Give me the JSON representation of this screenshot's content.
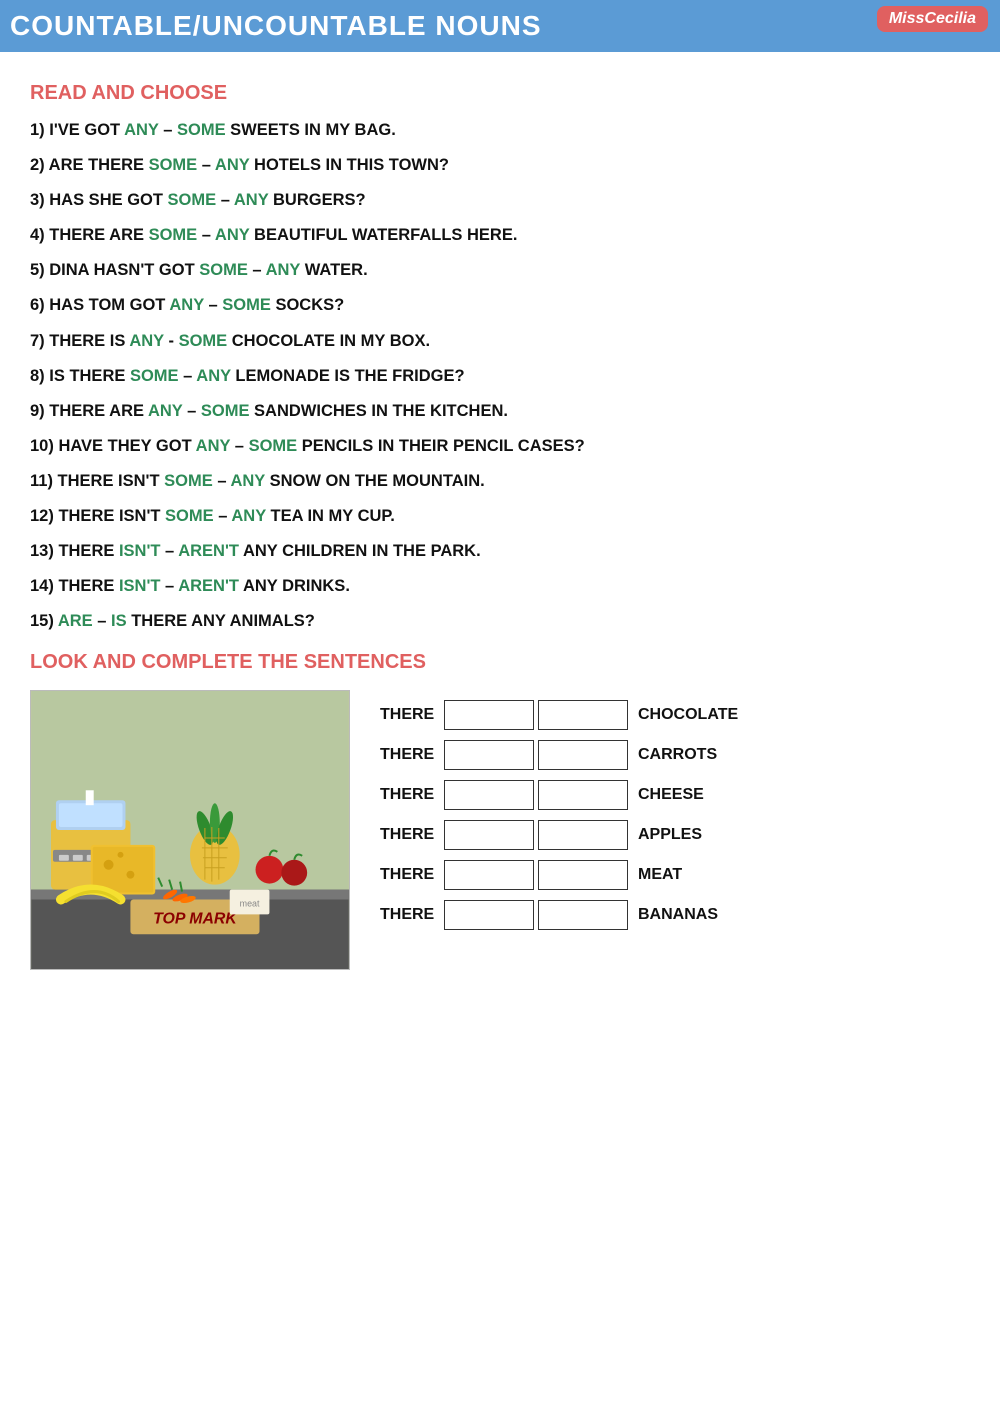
{
  "header": {
    "title": "COUNTABLE/UNCOUNTABLE NOUNS",
    "brand": "MissCecilia"
  },
  "section1": {
    "heading": "READ AND CHOOSE",
    "questions": [
      {
        "num": "1)",
        "prefix": "I'VE GOT ",
        "choice1": "ANY",
        "sep": " – ",
        "choice2": "SOME",
        "suffix": " SWEETS IN MY BAG.",
        "c1color": "green",
        "c2color": "green"
      },
      {
        "num": "2)",
        "prefix": "ARE THERE ",
        "choice1": "SOME",
        "sep": " – ",
        "choice2": "ANY",
        "suffix": " HOTELS IN THIS TOWN?",
        "c1color": "green",
        "c2color": "green"
      },
      {
        "num": "3)",
        "prefix": "HAS SHE GOT ",
        "choice1": "SOME",
        "sep": " – ",
        "choice2": "ANY",
        "suffix": " BURGERS?",
        "c1color": "green",
        "c2color": "green"
      },
      {
        "num": "4)",
        "prefix": "THERE ARE ",
        "choice1": "SOME",
        "sep": " – ",
        "choice2": "ANY",
        "suffix": " BEAUTIFUL WATERFALLS HERE.",
        "c1color": "green",
        "c2color": "green"
      },
      {
        "num": "5)",
        "prefix": "DINA HASN'T GOT ",
        "choice1": "SOME",
        "sep": " – ",
        "choice2": "ANY",
        "suffix": " WATER.",
        "c1color": "green",
        "c2color": "green"
      },
      {
        "num": "6)",
        "prefix": "HAS TOM GOT ",
        "choice1": "ANY",
        "sep": " – ",
        "choice2": "SOME",
        "suffix": " SOCKS?",
        "c1color": "green",
        "c2color": "green"
      },
      {
        "num": "7)",
        "prefix": "THERE IS ",
        "choice1": "ANY",
        "sep": " - ",
        "choice2": "SOME",
        "suffix": " CHOCOLATE IN MY BOX.",
        "c1color": "green",
        "c2color": "green"
      },
      {
        "num": "8)",
        "prefix": "IS THERE ",
        "choice1": "SOME",
        "sep": " – ",
        "choice2": "ANY",
        "suffix": " LEMONADE IS THE FRIDGE?",
        "c1color": "green",
        "c2color": "green"
      },
      {
        "num": "9)",
        "prefix": "THERE ARE ",
        "choice1": "ANY",
        "sep": " – ",
        "choice2": "SOME",
        "suffix": " SANDWICHES IN THE KITCHEN.",
        "c1color": "green",
        "c2color": "green"
      },
      {
        "num": "10)",
        "prefix": "HAVE THEY GOT ",
        "choice1": "ANY",
        "sep": " – ",
        "choice2": "SOME",
        "suffix": " PENCILS IN THEIR PENCIL CASES?",
        "c1color": "green",
        "c2color": "green"
      },
      {
        "num": "11)",
        "prefix": "THERE ISN'T ",
        "choice1": "SOME",
        "sep": " – ",
        "choice2": "ANY",
        "suffix": " SNOW ON THE MOUNTAIN.",
        "c1color": "green",
        "c2color": "green"
      },
      {
        "num": "12)",
        "prefix": "THERE ISN'T ",
        "choice1": "SOME",
        "sep": " – ",
        "choice2": "ANY",
        "suffix": " TEA IN MY CUP.",
        "c1color": "green",
        "c2color": "green"
      },
      {
        "num": "13)",
        "prefix": "THERE ",
        "choice1": "ISN'T",
        "sep": " – ",
        "choice2": "AREN'T",
        "suffix": " ANY CHILDREN IN THE PARK.",
        "c1color": "green",
        "c2color": "green"
      },
      {
        "num": "14)",
        "prefix": "THERE ",
        "choice1": "ISN'T",
        "sep": " – ",
        "choice2": "AREN'T",
        "suffix": " ANY DRINKS.",
        "c1color": "green",
        "c2color": "green"
      },
      {
        "num": "15)",
        "prefix": "",
        "choice1": "ARE",
        "sep": " – ",
        "choice2": "IS",
        "suffix": " THERE ANY ANIMALS?",
        "c1color": "green",
        "c2color": "green"
      }
    ]
  },
  "section2": {
    "heading": "LOOK AND COMPLETE THE SENTENCES",
    "rows": [
      {
        "there": "THERE",
        "noun": "CHOCOLATE"
      },
      {
        "there": "THERE",
        "noun": "CARROTS"
      },
      {
        "there": "THERE",
        "noun": "CHEESE"
      },
      {
        "there": "THERE",
        "noun": "APPLES"
      },
      {
        "there": "THERE",
        "noun": "MEAT"
      },
      {
        "there": "THERE",
        "noun": "BANANAS"
      }
    ]
  }
}
